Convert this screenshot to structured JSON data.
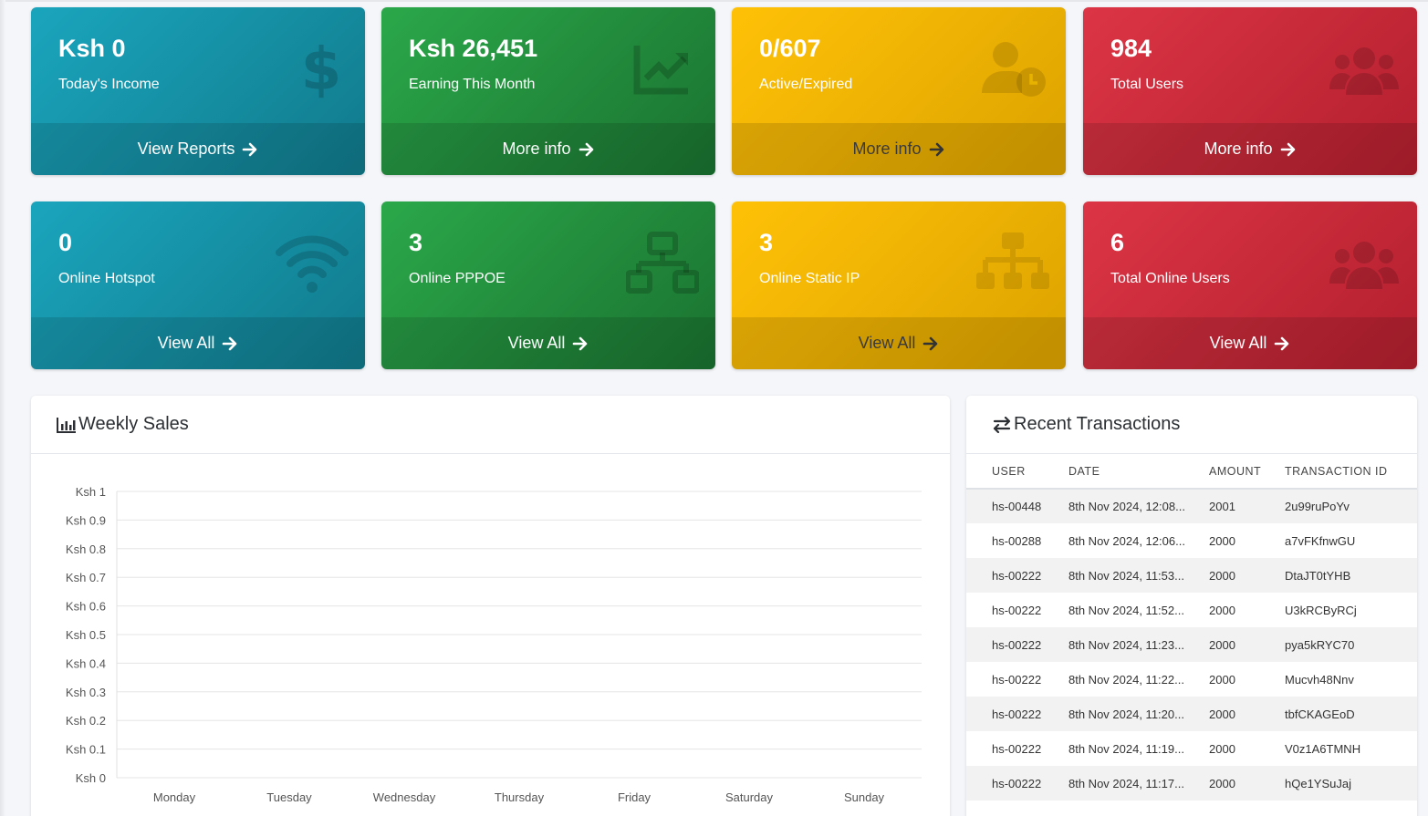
{
  "boxes": [
    {
      "value": "Ksh 0",
      "label": "Today's Income",
      "footer": "View Reports",
      "icon": "dollar-icon",
      "color": "#17a2b8"
    },
    {
      "value": "Ksh 26,451",
      "label": "Earning This Month",
      "footer": "More info",
      "icon": "chart-line-icon",
      "color": "#28a745"
    },
    {
      "value": "0/607",
      "label": "Active/Expired",
      "footer": "More info",
      "icon": "user-clock-icon",
      "color": "#ffc107"
    },
    {
      "value": "984",
      "label": "Total Users",
      "footer": "More info",
      "icon": "users-icon",
      "color": "#dc3545"
    },
    {
      "value": "0",
      "label": "Online Hotspot",
      "footer": "View All",
      "icon": "wifi-icon",
      "color": "#17a2b8"
    },
    {
      "value": "3",
      "label": "Online PPPOE",
      "footer": "View All",
      "icon": "network-icon",
      "color": "#28a745"
    },
    {
      "value": "3",
      "label": "Online Static IP",
      "footer": "View All",
      "icon": "sitemap-icon",
      "color": "#ffc107"
    },
    {
      "value": "6",
      "label": "Total Online Users",
      "footer": "View All",
      "icon": "users-icon",
      "color": "#dc3545"
    }
  ],
  "weekly_sales": {
    "title": "Weekly Sales"
  },
  "chart_data": {
    "type": "line",
    "title": "",
    "categories": [
      "Monday",
      "Tuesday",
      "Wednesday",
      "Thursday",
      "Friday",
      "Saturday",
      "Sunday"
    ],
    "series": [
      {
        "values": [
          0,
          0,
          0,
          0,
          0,
          0,
          0
        ]
      }
    ],
    "y_ticks": [
      "Ksh 0",
      "Ksh 0.1",
      "Ksh 0.2",
      "Ksh 0.3",
      "Ksh 0.4",
      "Ksh 0.5",
      "Ksh 0.6",
      "Ksh 0.7",
      "Ksh 0.8",
      "Ksh 0.9",
      "Ksh 1"
    ],
    "ylim": [
      0,
      1
    ],
    "grid": true
  },
  "transactions": {
    "title": "Recent Transactions",
    "columns": [
      "USER",
      "DATE",
      "AMOUNT",
      "TRANSACTION ID"
    ],
    "rows": [
      [
        "hs-00448",
        "8th Nov 2024, 12:08...",
        "2001",
        "2u99ruPoYv"
      ],
      [
        "hs-00288",
        "8th Nov 2024, 12:06...",
        "2000",
        "a7vFKfnwGU"
      ],
      [
        "hs-00222",
        "8th Nov 2024, 11:53...",
        "2000",
        "DtaJT0tYHB"
      ],
      [
        "hs-00222",
        "8th Nov 2024, 11:52...",
        "2000",
        "U3kRCByRCj"
      ],
      [
        "hs-00222",
        "8th Nov 2024, 11:23...",
        "2000",
        "pya5kRYC70"
      ],
      [
        "hs-00222",
        "8th Nov 2024, 11:22...",
        "2000",
        "Mucvh48Nnv"
      ],
      [
        "hs-00222",
        "8th Nov 2024, 11:20...",
        "2000",
        "tbfCKAGEoD"
      ],
      [
        "hs-00222",
        "8th Nov 2024, 11:19...",
        "2000",
        "V0z1A6TMNH"
      ],
      [
        "hs-00222",
        "8th Nov 2024, 11:17...",
        "2000",
        "hQe1YSuJaj"
      ]
    ]
  }
}
